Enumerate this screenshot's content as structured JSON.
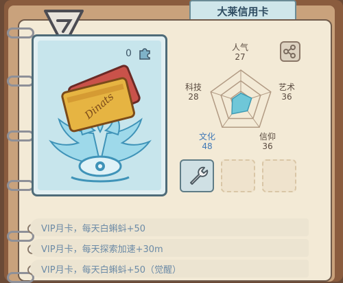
{
  "header": {
    "title": "大莱信用卡"
  },
  "card": {
    "count": "0",
    "card_text": "Dinats"
  },
  "stats": [
    {
      "label": "人气",
      "value": "27"
    },
    {
      "label": "艺术",
      "value": "36"
    },
    {
      "label": "信仰",
      "value": "36"
    },
    {
      "label": "文化",
      "value": "48"
    },
    {
      "label": "科技",
      "value": "28"
    }
  ],
  "chart_data": {
    "type": "radar",
    "axes": [
      "人气",
      "艺术",
      "信仰",
      "文化",
      "科技"
    ],
    "values": [
      27,
      36,
      36,
      48,
      28
    ],
    "max": 100
  },
  "slots": [
    {
      "state": "filled",
      "icon": "wrench-icon"
    },
    {
      "state": "empty"
    },
    {
      "state": "empty"
    }
  ],
  "perks": [
    "VIP月卡，每天白蝌蚪+50",
    "VIP月卡，每天探索加速+30m",
    "VIP月卡，每天白蝌蚪+50（觉醒）"
  ],
  "colors": {
    "radar_fill": "#6fc7d8",
    "tab_bg": "#cfe6ea",
    "page_bg": "#f3ead6"
  }
}
